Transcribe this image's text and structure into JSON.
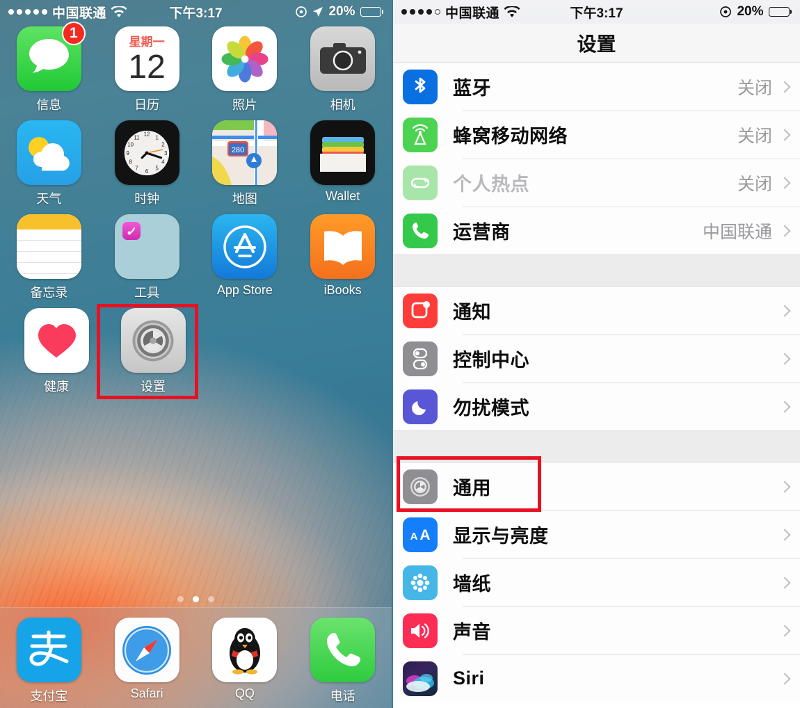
{
  "home": {
    "status_bar": {
      "signal_dots": 5,
      "signal_filled": 5,
      "carrier": "中国联通",
      "wifi_icon": "wifi-icon",
      "time": "下午3:17",
      "rotation_lock_icon": "rotation-lock-icon",
      "location_icon": "location-arrow-icon",
      "battery_percent": "20%",
      "battery_level": 20
    },
    "rows": [
      [
        {
          "name": "信息",
          "icon": "messages-icon",
          "badge": "1"
        },
        {
          "name": "日历",
          "icon": "calendar-icon",
          "weekday": "星期一",
          "day": "12"
        },
        {
          "name": "照片",
          "icon": "photos-icon"
        },
        {
          "name": "相机",
          "icon": "camera-icon"
        }
      ],
      [
        {
          "name": "天气",
          "icon": "weather-icon"
        },
        {
          "name": "时钟",
          "icon": "clock-icon"
        },
        {
          "name": "地图",
          "icon": "maps-icon",
          "shield": "280"
        },
        {
          "name": "Wallet",
          "icon": "wallet-icon"
        }
      ],
      [
        {
          "name": "备忘录",
          "icon": "notes-icon"
        },
        {
          "name": "工具",
          "icon": "folder-utilities-icon"
        },
        {
          "name": "App Store",
          "icon": "appstore-icon"
        },
        {
          "name": "iBooks",
          "icon": "ibooks-icon"
        }
      ],
      [
        {
          "name": "健康",
          "icon": "health-icon"
        },
        {
          "name": "设置",
          "icon": "settings-gear-icon",
          "highlighted": true
        }
      ]
    ],
    "page_dots": {
      "count": 3,
      "active_index": 1
    },
    "dock": [
      {
        "name": "支付宝",
        "icon": "alipay-icon"
      },
      {
        "name": "Safari",
        "icon": "safari-compass-icon"
      },
      {
        "name": "QQ",
        "icon": "qq-penguin-icon"
      },
      {
        "name": "电话",
        "icon": "phone-icon"
      }
    ]
  },
  "settings": {
    "status_bar": {
      "signal_dots": 5,
      "signal_filled": 4,
      "carrier": "中国联通",
      "wifi_icon": "wifi-icon",
      "time": "下午3:17",
      "rotation_lock_icon": "rotation-lock-icon",
      "battery_percent": "20%",
      "battery_level": 20
    },
    "title": "设置",
    "group_1": [
      {
        "label": "蓝牙",
        "value": "关闭",
        "icon": "bluetooth-icon",
        "color": "#0a6fe0",
        "dim": false
      },
      {
        "label": "蜂窝移动网络",
        "value": "关闭",
        "icon": "cellular-icon",
        "color": "#4cd352",
        "dim": false
      },
      {
        "label": "个人热点",
        "value": "关闭",
        "icon": "hotspot-icon",
        "color": "#a7e5a8",
        "dim": true
      },
      {
        "label": "运营商",
        "value": "中国联通",
        "icon": "carrier-phone-icon",
        "color": "#34c94a",
        "dim": false
      }
    ],
    "group_2": [
      {
        "label": "通知",
        "value": "",
        "icon": "notifications-icon",
        "color": "#fc3d39",
        "dim": false
      },
      {
        "label": "控制中心",
        "value": "",
        "icon": "control-center-icon",
        "color": "#8e8e93",
        "dim": false
      },
      {
        "label": "勿扰模式",
        "value": "",
        "icon": "do-not-disturb-icon",
        "color": "#5957d6",
        "dim": false
      }
    ],
    "group_3": [
      {
        "label": "通用",
        "value": "",
        "icon": "general-gear-icon",
        "color": "#8e8e93",
        "dim": false,
        "highlighted": true
      },
      {
        "label": "显示与亮度",
        "value": "",
        "icon": "display-brightness-icon",
        "color": "#157efb",
        "dim": false
      },
      {
        "label": "墙纸",
        "value": "",
        "icon": "wallpaper-icon",
        "color": "#45b6e6",
        "dim": false
      },
      {
        "label": "声音",
        "value": "",
        "icon": "sounds-icon",
        "color": "#fc2d55",
        "dim": false
      },
      {
        "label": "Siri",
        "value": "",
        "icon": "siri-icon",
        "color": "#2a2540",
        "dim": false
      }
    ]
  },
  "annotations": {
    "highlight_color": "#e81123",
    "boxes": [
      {
        "target": "设置",
        "pane": "home"
      },
      {
        "target": "通用",
        "pane": "settings"
      }
    ]
  }
}
